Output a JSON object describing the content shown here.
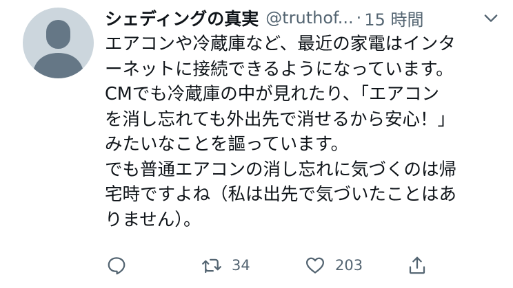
{
  "tweet": {
    "display_name": "シェディングの真実",
    "handle": "@truthof...",
    "separator": "·",
    "time": "15 時間",
    "lines": [
      "エアコンや冷蔵庫など、最近の家電はインタ",
      "ーネットに接続できるようになっています。",
      "CMでも冷蔵庫の中が見れたり、「エアコン",
      "を消し忘れても外出先で消せるから安心！」",
      "みたいなことを謳っています。",
      "でも普通エアコンの消し忘れに気づくのは帰",
      "宅時ですよね（私は出先で気づいたことはあ",
      "りません）。"
    ],
    "retweets": "34",
    "likes": "203"
  },
  "icons": {
    "avatar": "default-avatar-icon",
    "more": "chevron-down-icon",
    "reply": "reply-icon",
    "retweet": "retweet-icon",
    "like": "heart-icon",
    "share": "share-icon"
  },
  "colors": {
    "text": "#0f1419",
    "secondary": "#536471",
    "avatar_bg": "#ccd6dd",
    "avatar_fg": "#657786"
  }
}
